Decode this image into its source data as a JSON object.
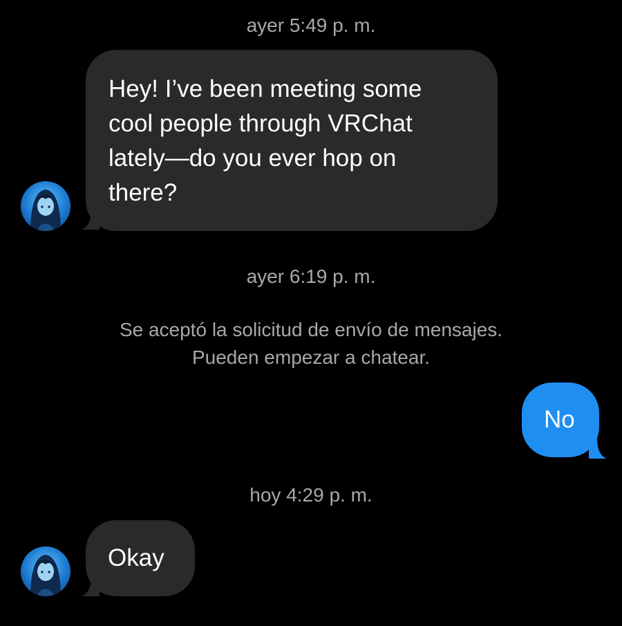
{
  "thread": {
    "timestamps": [
      "ayer 5:49 p. m.",
      "ayer 6:19 p. m.",
      "hoy 4:29 p. m."
    ],
    "system_note": {
      "line1": "Se aceptó la solicitud de envío de mensajes.",
      "line2": "Pueden empezar a chatear."
    },
    "messages": [
      {
        "direction": "incoming",
        "lines": [
          "Hey! I’ve been meeting some",
          "cool people through VRChat",
          "lately—do you ever hop on",
          "there?"
        ]
      },
      {
        "direction": "outgoing",
        "text": "No"
      },
      {
        "direction": "incoming",
        "text": "Okay"
      }
    ]
  },
  "avatar": {
    "icon": "anime-character-avatar",
    "color": "#1a78d0"
  },
  "colors": {
    "background": "#000000",
    "incoming_bubble": "#2a2a2c",
    "outgoing_bubble": "#1f8ef2",
    "meta_text": "#a7a8ad"
  }
}
